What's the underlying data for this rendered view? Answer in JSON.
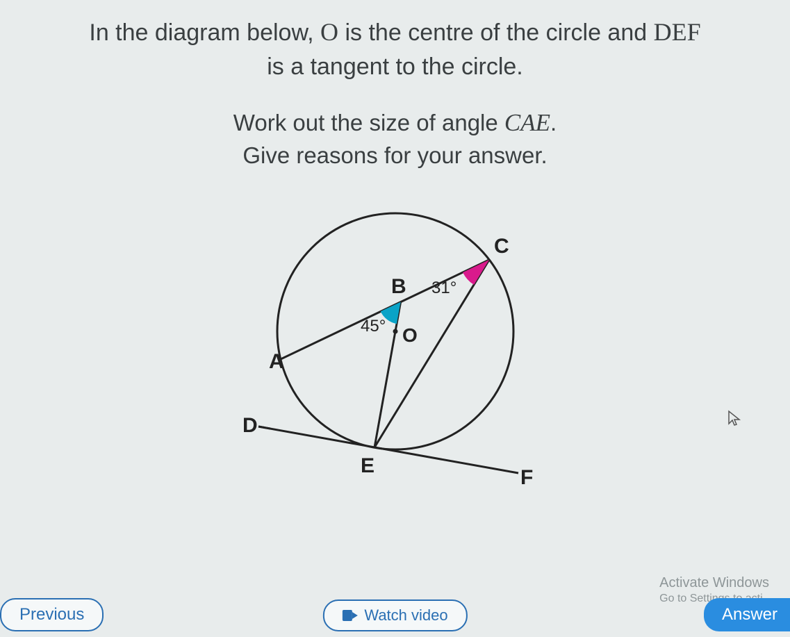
{
  "question": {
    "line1_pre": "In the diagram below, ",
    "center_var": "O",
    "line1_mid": " is the centre of the circle and ",
    "tangent_var": "DEF",
    "line2": "is a tangent to the circle.",
    "work_line1_pre": "Work out the size of angle ",
    "angle_var": "CAE",
    "work_line1_post": ".",
    "work_line2": "Give reasons for your answer."
  },
  "diagram": {
    "labels": {
      "A": "A",
      "B": "B",
      "C": "C",
      "D": "D",
      "E": "E",
      "F": "F",
      "O": "O"
    },
    "angle_ABE": "45°",
    "angle_BCE": "31°"
  },
  "buttons": {
    "previous": "Previous",
    "watch": "Watch video",
    "answer": "Answer"
  },
  "watermark": {
    "title": "Activate Windows",
    "sub": "Go to Settings to acti"
  },
  "colors": {
    "cyan_fill": "#0aa3c7",
    "magenta_fill": "#d91a8c",
    "stroke": "#222"
  }
}
